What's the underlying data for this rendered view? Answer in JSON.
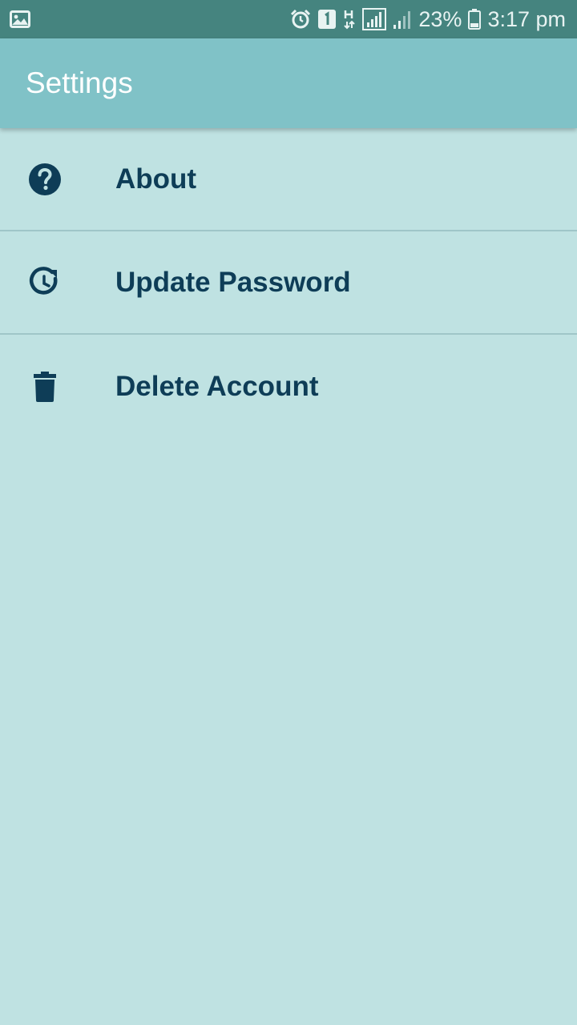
{
  "status_bar": {
    "icons_left": [
      "image-icon"
    ],
    "icons_right": [
      "alarm-icon",
      "sim-1-icon",
      "h-data-icon",
      "signal-icon",
      "signal-weak-icon",
      "battery-icon"
    ],
    "battery_percent": "23%",
    "time": "3:17 pm",
    "colors": {
      "background": "#45847f",
      "foreground": "#e8f3f2"
    }
  },
  "app_bar": {
    "title": "Settings",
    "colors": {
      "background": "#80c2c7",
      "title": "#ffffff"
    }
  },
  "settings": {
    "items": [
      {
        "label": "About",
        "icon": "help-circle-icon"
      },
      {
        "label": "Update Password",
        "icon": "refresh-clock-icon"
      },
      {
        "label": "Delete Account",
        "icon": "trash-icon"
      }
    ]
  },
  "colors": {
    "page_background": "#bfe2e2",
    "item_text": "#0e3d57",
    "divider": "#9fc6c8"
  }
}
